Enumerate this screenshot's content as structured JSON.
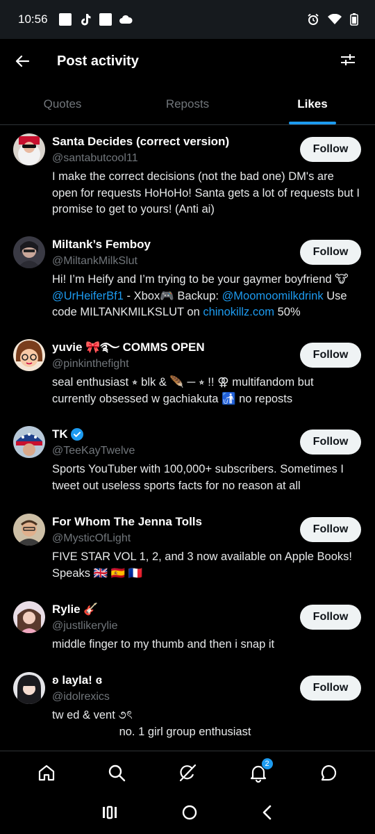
{
  "status_bar": {
    "time": "10:56"
  },
  "header": {
    "title": "Post activity"
  },
  "tabs": [
    {
      "label": "Quotes",
      "active": false
    },
    {
      "label": "Reposts",
      "active": false
    },
    {
      "label": "Likes",
      "active": true
    }
  ],
  "users": [
    {
      "name": "Santa Decides (correct version)",
      "handle": "@santabutcool11",
      "bio": "I make the correct decisions (not the bad one) DM's are open for requests HoHoHo! Santa gets a lot of requests but I promise to get to yours! (Anti ai)",
      "follow_label": "Follow"
    },
    {
      "name": "Miltank’s Femboy",
      "handle": "@MiltankMilkSlut",
      "bio_parts": {
        "p1": "Hi! I’m Heify and I’m trying to be your gaymer boyfriend 🐮 ",
        "link1": "@UrHeiferBf1",
        "p2": " - Xbox🎮 Backup: ",
        "link2": "@Moomoomilkdrink",
        "p3": " Use code MILTANKMILKSLUT on ",
        "link3": "chinokillz.com",
        "p4": " 50%"
      },
      "follow_label": "Follow"
    },
    {
      "name": "yuvie 🎀࿐ COMMS OPEN",
      "handle": "@pinkinthefight",
      "bio": "seal enthusiast ⭒ blk & 🪶 ─ ⭒ !! ⚢ multifandom but currently obsessed w gachiakuta 🚮 no reposts",
      "follow_label": "Follow"
    },
    {
      "name": "TK",
      "handle": "@TeeKayTwelve",
      "bio": "Sports YouTuber with 100,000+ subscribers. Sometimes I tweet out useless sports facts for no reason at all",
      "follow_label": "Follow",
      "verified": true
    },
    {
      "name": "For Whom The Jenna Tolls",
      "handle": "@MysticOfLight",
      "bio": "FIVE STAR VOL 1, 2, and 3 now available on Apple Books! Speaks 🇬🇧 🇪🇸 🇫🇷",
      "follow_label": "Follow"
    },
    {
      "name": "Rylie 🎸",
      "handle": "@justlikerylie",
      "bio": "middle finger to my thumb and then i snap it",
      "follow_label": "Follow"
    },
    {
      "name": "ʚ layla! ɞ",
      "handle": "@idolrexics",
      "bio_line1": "tw ed & vent ૭ৎ",
      "bio_line2": "no. 1 girl group enthusiast",
      "follow_label": "Follow"
    }
  ],
  "bottom_nav": {
    "items": [
      "home-icon",
      "search-icon",
      "grok-icon",
      "notifications-icon",
      "messages-icon"
    ],
    "notification_count": "2"
  },
  "colors": {
    "accent": "#1d9bf0",
    "background": "#000000",
    "text": "#e7e9ea",
    "muted": "#71767b"
  }
}
